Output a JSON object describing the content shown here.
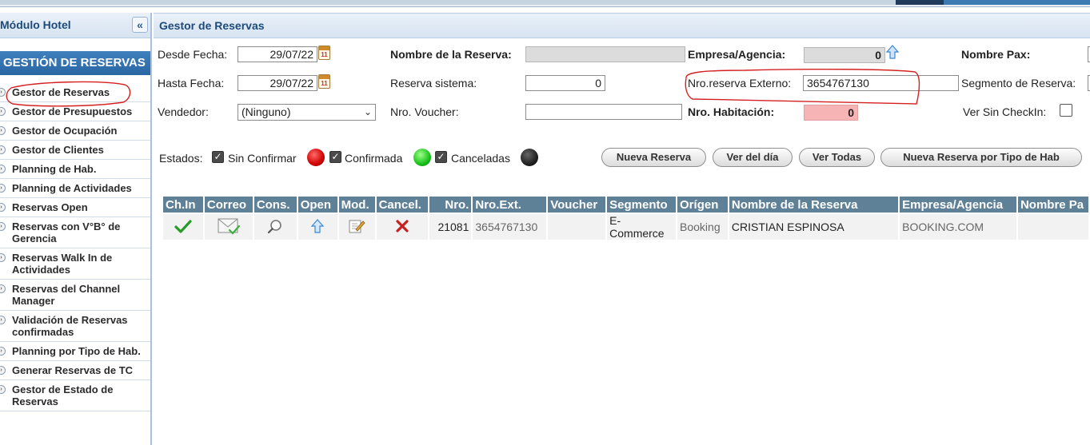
{
  "sidebar": {
    "title": "Módulo Hotel",
    "collapse": "«",
    "section": "GESTIÓN DE RESERVAS",
    "items": [
      "Gestor de Reservas",
      "Gestor de Presupuestos",
      "Gestor de Ocupación",
      "Gestor de Clientes",
      "Planning de Hab.",
      "Planning de Actividades",
      "Reservas Open",
      "Reservas con V°B° de Gerencia",
      "Reservas Walk In de Actividades",
      "Reservas del Channel Manager",
      "Validación de Reservas confirmadas",
      "Planning por Tipo de Hab.",
      "Generar Reservas de TC",
      "Gestor de Estado de Reservas"
    ]
  },
  "main": {
    "title": "Gestor de Reservas",
    "form": {
      "desde_label": "Desde Fecha:",
      "desde_value": "29/07/22",
      "hasta_label": "Hasta Fecha:",
      "hasta_value": "29/07/22",
      "vendedor_label": "Vendedor:",
      "vendedor_value": "(Ninguno)",
      "nombre_reserva_label": "Nombre de la Reserva:",
      "nombre_reserva_value": "",
      "reserva_sistema_label": "Reserva sistema:",
      "reserva_sistema_value": "0",
      "voucher_label": "Nro. Voucher:",
      "voucher_value": "",
      "empresa_label": "Empresa/Agencia:",
      "empresa_value": "0",
      "externo_label": "Nro.reserva Externo:",
      "externo_value": "3654767130",
      "habitacion_label": "Nro. Habitación:",
      "habitacion_value": "0",
      "nombre_pax_label": "Nombre Pax:",
      "segmento_label": "Segmento de Reserva:",
      "ver_sin_checkin_label": "Ver Sin CheckIn:"
    },
    "estados": {
      "label": "Estados:",
      "sin_confirmar": "Sin Confirmar",
      "confirmada": "Confirmada",
      "canceladas": "Canceladas"
    },
    "buttons": {
      "nueva": "Nueva Reserva",
      "ver_dia": "Ver del día",
      "ver_todas": "Ver Todas",
      "nueva_tipo": "Nueva Reserva por Tipo de Hab"
    },
    "table": {
      "headers": [
        "Ch.In",
        "Correo",
        "Cons.",
        "Open",
        "Mod.",
        "Cancel.",
        "Nro.",
        "Nro.Ext.",
        "Voucher",
        "Segmento",
        "Orígen",
        "Nombre de la Reserva",
        "Empresa/Agencia",
        "Nombre Pa"
      ],
      "rows": [
        {
          "nro": "21081",
          "nro_ext": "3654767130",
          "voucher": "",
          "segmento": "E-\nCommerce",
          "origen": "Booking",
          "nombre": "CRISTIAN ESPINOSA",
          "empresa": "BOOKING.COM",
          "pax": ""
        }
      ]
    }
  },
  "icons": {
    "checkin": "check-icon",
    "correo": "envelope-icon",
    "consulta": "magnifier-icon",
    "open": "up-arrow-icon",
    "modificar": "edit-icon",
    "cancelar": "cross-icon",
    "calendar": "calendar-icon"
  },
  "colors": {
    "header_blue": "#1e4a7a",
    "section_blue": "#2a66a3",
    "table_header": "#5f8197",
    "annotation_red": "#d52020",
    "pink_field": "#f6b4b4"
  }
}
